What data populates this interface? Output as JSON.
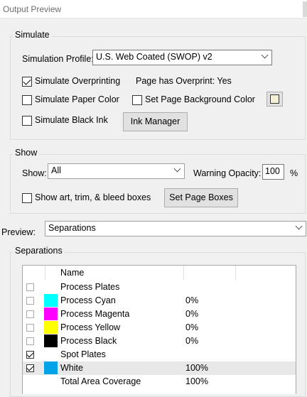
{
  "window": {
    "title": "Output Preview"
  },
  "simulate": {
    "legend": "Simulate",
    "profile_label": "Simulation Profile:",
    "profile_value": "U.S. Web Coated (SWOP) v2",
    "overprinting_label": "Simulate Overprinting",
    "overprinting_checked": true,
    "overprint_status": "Page has Overprint:  Yes",
    "paper_color_label": "Simulate Paper Color",
    "paper_color_checked": false,
    "page_bg_label": "Set Page Background Color",
    "page_bg_checked": false,
    "page_bg_swatch_color": "#f3f0d6",
    "black_ink_label": "Simulate Black Ink",
    "black_ink_checked": false,
    "ink_manager_label": "Ink Manager"
  },
  "show": {
    "legend": "Show",
    "show_label": "Show:",
    "show_value": "All",
    "warning_opacity_label": "Warning Opacity:",
    "warning_opacity_value": "100",
    "percent_sign": "%",
    "boxes_label": "Show art, trim, & bleed boxes",
    "boxes_checked": false,
    "set_page_boxes_label": "Set Page Boxes"
  },
  "preview": {
    "label": "Preview:",
    "value": "Separations"
  },
  "separations": {
    "legend": "Separations",
    "name_header": "Name",
    "rows": [
      {
        "name": "Process Plates",
        "percent": "",
        "color": "",
        "checked": false,
        "selected": false
      },
      {
        "name": "Process Cyan",
        "percent": "0%",
        "color": "#00ffff",
        "checked": false,
        "selected": false
      },
      {
        "name": "Process Magenta",
        "percent": "0%",
        "color": "#ff00ff",
        "checked": false,
        "selected": false
      },
      {
        "name": "Process Yellow",
        "percent": "0%",
        "color": "#ffff00",
        "checked": false,
        "selected": false
      },
      {
        "name": "Process Black",
        "percent": "0%",
        "color": "#000000",
        "checked": false,
        "selected": false
      },
      {
        "name": "Spot Plates",
        "percent": "",
        "color": "",
        "checked": true,
        "selected": false
      },
      {
        "name": "White",
        "percent": "100%",
        "color": "#00a2e8",
        "checked": true,
        "selected": true
      },
      {
        "name": "Total Area Coverage",
        "percent": "100%",
        "color": "",
        "checked": null,
        "selected": false
      }
    ]
  }
}
